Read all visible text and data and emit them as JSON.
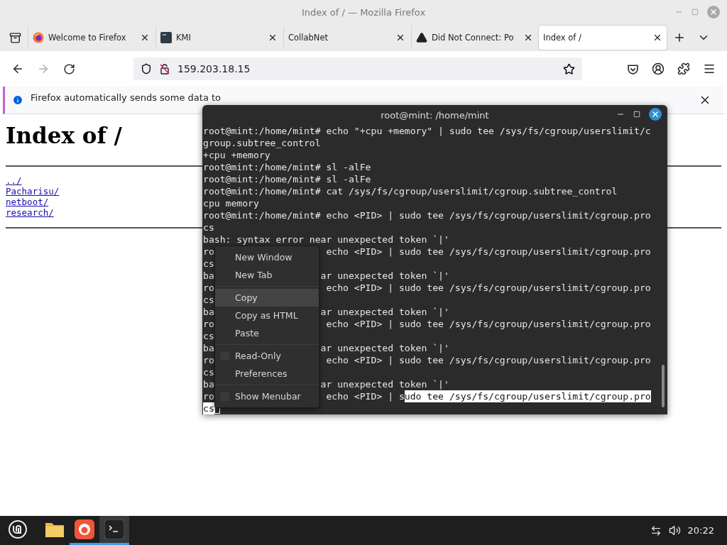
{
  "window": {
    "title": "Index of / — Mozilla Firefox"
  },
  "tabs": [
    {
      "label": "Welcome to Firefox",
      "kind": "firefox",
      "selected": false
    },
    {
      "label": "KMI",
      "kind": "app",
      "selected": false
    },
    {
      "label": "CollabNet",
      "kind": "blank",
      "selected": false
    },
    {
      "label": "Did Not Connect: Po",
      "kind": "warning",
      "selected": false
    },
    {
      "label": "Index of /",
      "kind": "blank",
      "selected": true
    }
  ],
  "address": {
    "value": "159.203.18.15"
  },
  "notification": {
    "text": "Firefox automatically sends some data to"
  },
  "page": {
    "heading": "Index of /",
    "links": [
      "../",
      "Pacharisu/",
      "netboot/",
      "research/"
    ]
  },
  "terminal": {
    "title": "root@mint: /home/mint",
    "lines": [
      {
        "kind": "full",
        "text": "root@mint:/home/mint# echo \"+cpu +memory\" | sudo tee /sys/fs/cgroup/userslimit/c",
        "cursor": false
      },
      {
        "kind": "full",
        "text": "group.subtree_control",
        "cursor": false
      },
      {
        "kind": "full",
        "text": "+cpu +memory",
        "cursor": false
      },
      {
        "kind": "full",
        "text": "root@mint:/home/mint# sl -alFe",
        "cursor": false
      },
      {
        "kind": "full",
        "text": "root@mint:/home/mint# sl -alFe",
        "cursor": false
      },
      {
        "kind": "full",
        "text": "root@mint:/home/mint# cat /sys/fs/cgroup/userslimit/cgroup.subtree_control",
        "cursor": false
      },
      {
        "kind": "full",
        "text": "cpu memory",
        "cursor": false
      },
      {
        "kind": "full",
        "text": "root@mint:/home/mint# echo <PID> | sudo tee /sys/fs/cgroup/userslimit/cgroup.pro",
        "cursor": false
      },
      {
        "kind": "full",
        "text": "cs",
        "cursor": false
      },
      {
        "kind": "full",
        "text": "bash: syntax error near unexpected token `|'",
        "cursor": false
      },
      {
        "kind": "prompt",
        "left": "ro",
        "right": "echo <PID> | sudo tee /sys/fs/cgroup/userslimit/cgroup.pro",
        "cursor": false
      },
      {
        "kind": "full",
        "text": "cs",
        "cursor": false
      },
      {
        "kind": "error",
        "left": "ba",
        "right": "ar unexpected token `|'",
        "cursor": false
      },
      {
        "kind": "prompt",
        "left": "ro",
        "right": "echo <PID> | sudo tee /sys/fs/cgroup/userslimit/cgroup.pro",
        "cursor": false
      },
      {
        "kind": "full",
        "text": "cs",
        "cursor": false
      },
      {
        "kind": "error",
        "left": "ba",
        "right": "ar unexpected token `|'",
        "cursor": false
      },
      {
        "kind": "prompt",
        "left": "ro",
        "right": "echo <PID> | sudo tee /sys/fs/cgroup/userslimit/cgroup.pro",
        "cursor": false
      },
      {
        "kind": "full",
        "text": "cs",
        "cursor": false
      },
      {
        "kind": "error",
        "left": "ba",
        "right": "ar unexpected token `|'",
        "cursor": false
      },
      {
        "kind": "prompt",
        "left": "ro",
        "right": "echo <PID> | sudo tee /sys/fs/cgroup/userslimit/cgroup.pro",
        "cursor": false
      },
      {
        "kind": "full",
        "text": "cs",
        "cursor": false
      },
      {
        "kind": "error",
        "left": "ba",
        "right": "ar unexpected token `|'",
        "cursor": false
      },
      {
        "kind": "prompt",
        "left": "ro",
        "right": "echo <PID> | s",
        "selection": "udo tee /sys/fs/cgroup/userslimit/cgroup.pro",
        "cursor": false
      },
      {
        "kind": "full",
        "selection": "cs",
        "cursor": true
      }
    ]
  },
  "context_menu": {
    "groups": [
      [
        {
          "label": "New Window",
          "kind": "action",
          "selected": false
        },
        {
          "label": "New Tab",
          "kind": "action",
          "selected": false
        }
      ],
      [
        {
          "label": "Copy",
          "kind": "action",
          "selected": true
        },
        {
          "label": "Copy as HTML",
          "kind": "action",
          "selected": false
        },
        {
          "label": "Paste",
          "kind": "action",
          "selected": false
        }
      ],
      [
        {
          "label": "Read-Only",
          "kind": "check",
          "checked": false,
          "selected": false
        },
        {
          "label": "Preferences",
          "kind": "action",
          "selected": false
        }
      ],
      [
        {
          "label": "Show Menubar",
          "kind": "check",
          "checked": false,
          "selected": false
        }
      ]
    ]
  },
  "taskbar": {
    "apps": [
      {
        "kind": "files",
        "running": false,
        "selected": false
      },
      {
        "kind": "firefox",
        "running": true,
        "selected": false
      },
      {
        "kind": "terminal",
        "running": true,
        "selected": true
      }
    ],
    "clock": "20:22"
  }
}
